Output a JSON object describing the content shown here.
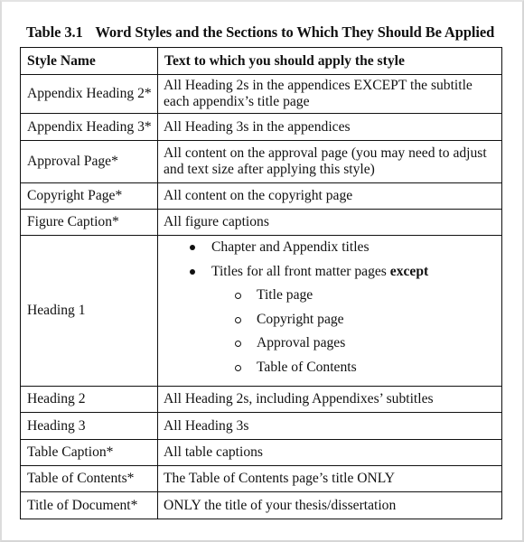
{
  "document": {
    "caption_number": "Table 3.1",
    "caption_title": "Word Styles and the Sections to Which They Should Be Applied"
  },
  "table": {
    "headers": [
      "Style Name",
      "Text to which you should apply the style"
    ],
    "rows": [
      {
        "style": "Appendix Heading 2*",
        "text": "All Heading 2s in the appendices EXCEPT the subtitle each appendix’s title page"
      },
      {
        "style": "Appendix Heading 3*",
        "text": "All Heading 3s in the appendices"
      },
      {
        "style": "Approval Page*",
        "text": "All content on the approval page (you may need to adjust and text size after applying this style)"
      },
      {
        "style": "Copyright Page*",
        "text": "All content on the copyright page"
      },
      {
        "style": "Figure Caption*",
        "text": "All figure captions"
      },
      {
        "style": "Heading 1",
        "list": {
          "item1": "Chapter and Appendix titles",
          "item2_text": "Titles for all front matter pages ",
          "item2_bold": "except",
          "subitems": [
            "Title page",
            "Copyright page",
            "Approval pages",
            "Table of Contents"
          ]
        }
      },
      {
        "style": "Heading 2",
        "text": "All Heading 2s, including Appendixes’ subtitles"
      },
      {
        "style": "Heading 3",
        "text": "All Heading 3s"
      },
      {
        "style": "Table Caption*",
        "text": "All table captions"
      },
      {
        "style": "Table of Contents*",
        "text": "The Table of Contents page’s title ONLY"
      },
      {
        "style": "Title of Document*",
        "text": "ONLY the title of your thesis/dissertation"
      }
    ]
  }
}
